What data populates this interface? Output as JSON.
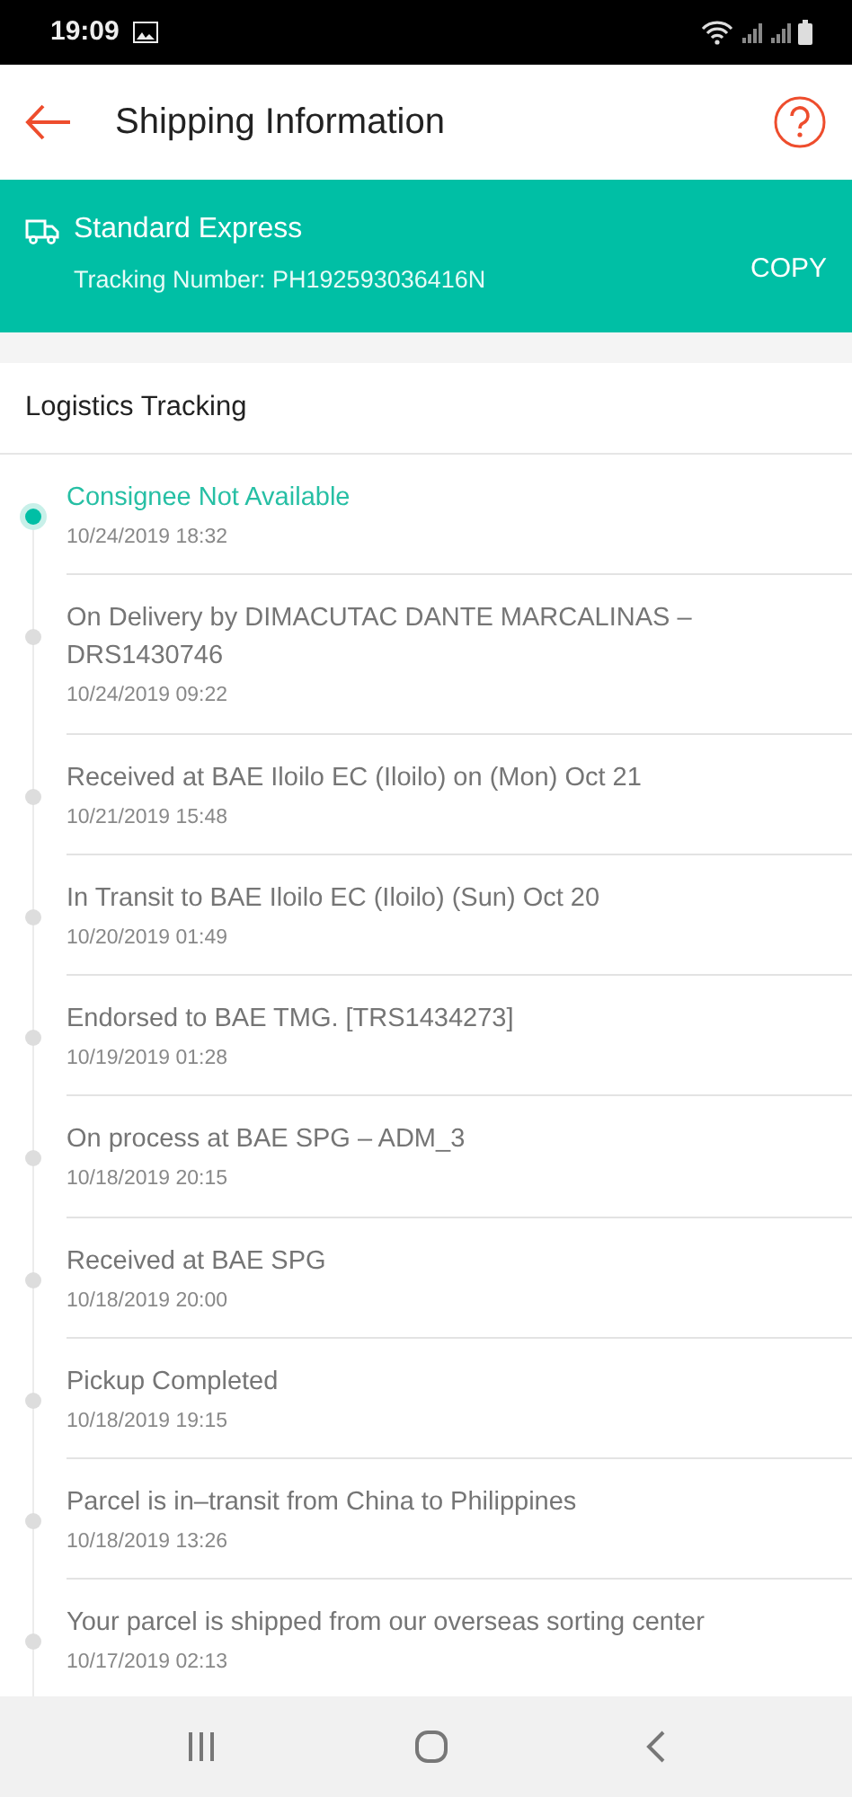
{
  "status_bar": {
    "time": "19:09"
  },
  "header": {
    "title": "Shipping Information"
  },
  "shipment": {
    "service": "Standard Express",
    "tracking_number": "Tracking Number: PH192593036416N",
    "copy_label": "COPY"
  },
  "tracking": {
    "title": "Logistics Tracking",
    "events": [
      {
        "text": "Consignee Not Available",
        "time": "10/24/2019 18:32",
        "current": true
      },
      {
        "text": "On Delivery by DIMACUTAC DANTE MARCALINAS – DRS1430746",
        "time": "10/24/2019 09:22",
        "current": false
      },
      {
        "text": "Received at BAE Iloilo EC (Iloilo) on (Mon) Oct 21",
        "time": "10/21/2019 15:48",
        "current": false
      },
      {
        "text": "In Transit to BAE Iloilo EC (Iloilo) (Sun) Oct 20",
        "time": "10/20/2019 01:49",
        "current": false
      },
      {
        "text": "Endorsed to BAE TMG. [TRS1434273]",
        "time": "10/19/2019 01:28",
        "current": false
      },
      {
        "text": "On process at BAE SPG – ADM_3",
        "time": "10/18/2019 20:15",
        "current": false
      },
      {
        "text": "Received at BAE SPG",
        "time": "10/18/2019 20:00",
        "current": false
      },
      {
        "text": "Pickup Completed",
        "time": "10/18/2019 19:15",
        "current": false
      },
      {
        "text": "Parcel is in–transit from China to Philippines",
        "time": "10/18/2019 13:26",
        "current": false
      },
      {
        "text": "Your parcel is shipped from our overseas sorting center",
        "time": "10/17/2019 02:13",
        "current": false
      }
    ]
  }
}
